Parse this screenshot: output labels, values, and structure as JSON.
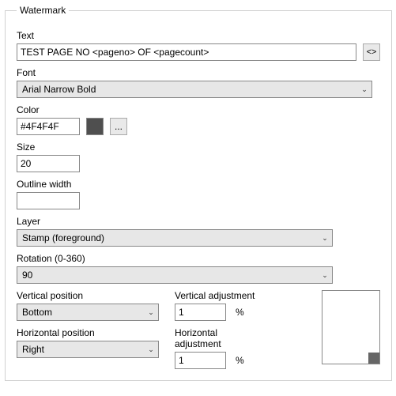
{
  "group": {
    "title": "Watermark"
  },
  "text": {
    "label": "Text",
    "value": "TEST PAGE NO <pageno> OF <pagecount>",
    "tag_btn": "<>"
  },
  "font": {
    "label": "Font",
    "value": "Arial Narrow Bold"
  },
  "color": {
    "label": "Color",
    "value": "#4F4F4F",
    "ellipsis": "..."
  },
  "size": {
    "label": "Size",
    "value": "20"
  },
  "outline": {
    "label": "Outline width",
    "value": ""
  },
  "layer": {
    "label": "Layer",
    "value": "Stamp (foreground)"
  },
  "rotation": {
    "label": "Rotation (0-360)",
    "value": "90"
  },
  "vpos": {
    "label": "Vertical position",
    "value": "Bottom"
  },
  "vadj": {
    "label": "Vertical adjustment",
    "value": "1",
    "unit": "%"
  },
  "hpos": {
    "label": "Horizontal position",
    "value": "Right"
  },
  "hadj": {
    "label": "Horizontal adjustment",
    "value": "1",
    "unit": "%"
  },
  "icons": {
    "chevron": "⌄"
  }
}
